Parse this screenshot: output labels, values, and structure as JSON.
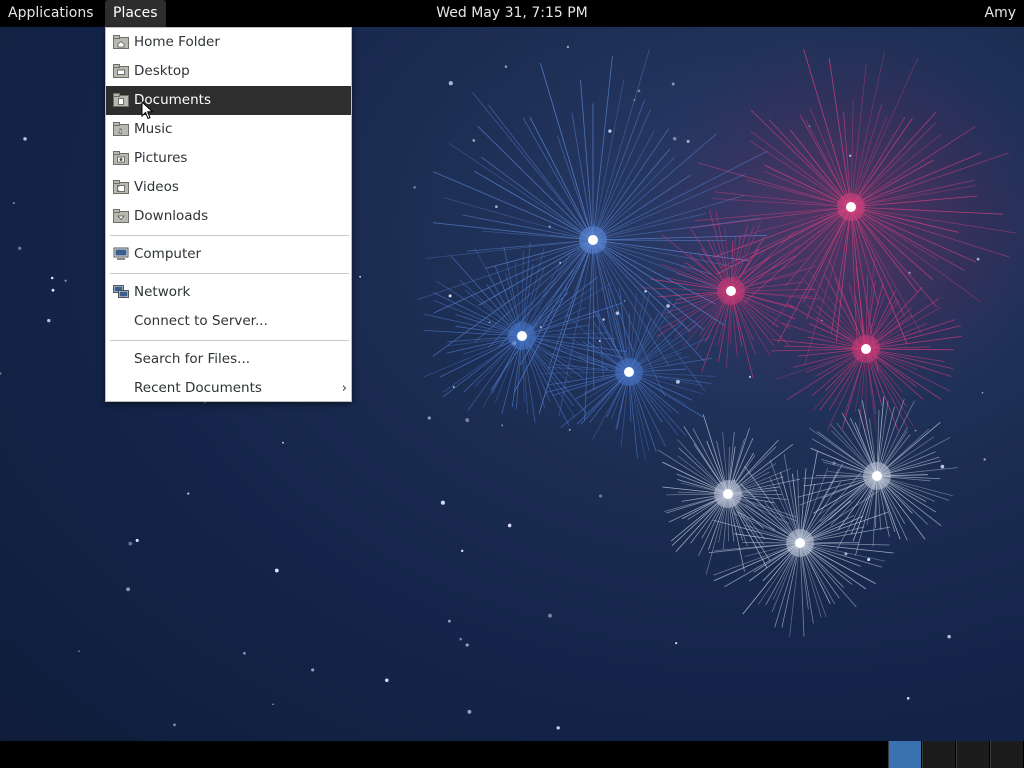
{
  "topbar": {
    "applications_label": "Applications",
    "places_label": "Places",
    "clock": "Wed May 31,  7:15 PM",
    "user": "Amy"
  },
  "places_menu": {
    "items": [
      {
        "label": "Home Folder",
        "icon": "home-folder-icon"
      },
      {
        "label": "Desktop",
        "icon": "desktop-folder-icon"
      },
      {
        "label": "Documents",
        "icon": "documents-folder-icon"
      },
      {
        "label": "Music",
        "icon": "music-folder-icon"
      },
      {
        "label": "Pictures",
        "icon": "pictures-folder-icon"
      },
      {
        "label": "Videos",
        "icon": "videos-folder-icon"
      },
      {
        "label": "Downloads",
        "icon": "downloads-folder-icon"
      },
      {
        "label": "Computer",
        "icon": "computer-icon"
      },
      {
        "label": "Network",
        "icon": "network-icon"
      },
      {
        "label": "Connect to Server...",
        "icon": ""
      },
      {
        "label": "Search for Files...",
        "icon": ""
      },
      {
        "label": "Recent Documents",
        "icon": ""
      }
    ],
    "highlighted": "Documents",
    "submenu_indicator": "›"
  },
  "workspaces": {
    "count": 4,
    "active_index": 0
  },
  "colors": {
    "highlight": "#2e2e2e",
    "workspace_active": "#3a72b0"
  }
}
